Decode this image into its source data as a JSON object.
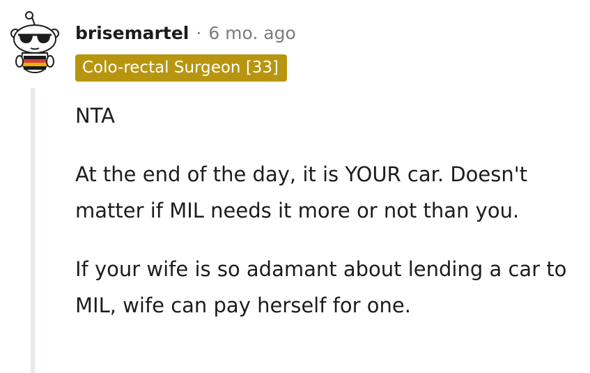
{
  "comment": {
    "author": "brisemartel",
    "separator": "·",
    "timestamp": "6 mo. ago",
    "flair": "Colo-rectal Surgeon [33]",
    "paragraphs": [
      "NTA",
      "At the end of the day, it is YOUR car. Doesn't matter if MIL needs it more or not than you.",
      "If your wife is so adamant about lending a car to MIL, wife can pay herself for one."
    ]
  },
  "colors": {
    "flair_background": "#b8950f",
    "flair_text": "#ffffff",
    "meta_gray": "#7c7c7c",
    "thread_line": "#e7eaec",
    "text": "#1c1c1c"
  },
  "icons": {
    "avatar": "snoo-avatar-icon"
  }
}
